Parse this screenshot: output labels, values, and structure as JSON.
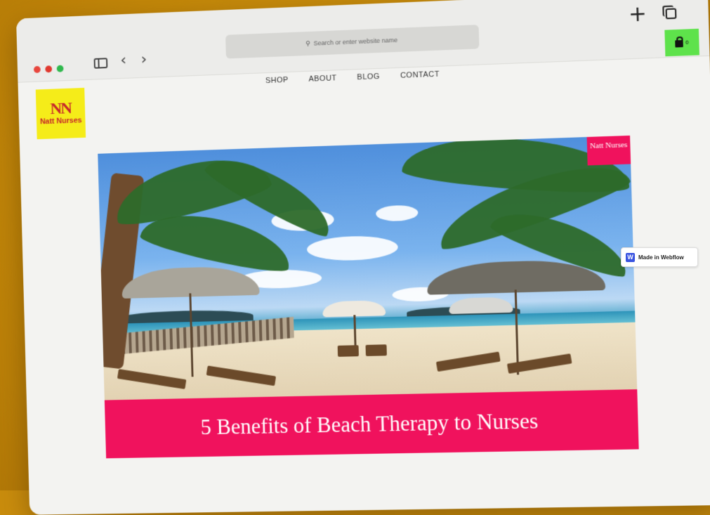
{
  "browser": {
    "address_placeholder": "Search or enter website name",
    "cart_count": "0"
  },
  "site": {
    "logo_mark": "NN",
    "logo_text": "Natt Nurses",
    "menu": [
      "SHOP",
      "ABOUT",
      "BLOG",
      "CONTACT"
    ]
  },
  "hero": {
    "badge": "Natt Nurses",
    "title": "5 Benefits of Beach Therapy to Nurses"
  },
  "webflow_badge": {
    "label": "Made in Webflow",
    "icon": "W"
  },
  "colors": {
    "background": "#c98c0c",
    "accent_pink": "#f0125d",
    "logo_yellow": "#f5ec19",
    "cart_green": "#5ee24b"
  }
}
